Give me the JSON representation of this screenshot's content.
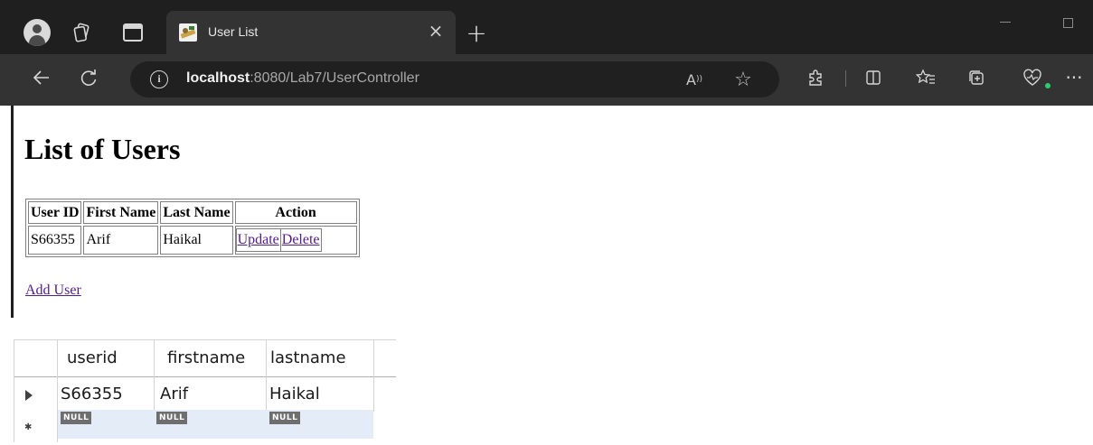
{
  "browser": {
    "tab": {
      "title": "User List"
    },
    "address": {
      "host": "localhost",
      "path": ":8080/Lab7/UserController"
    }
  },
  "page": {
    "title": "List of Users",
    "table": {
      "headers": [
        "User ID",
        "First Name",
        "Last Name",
        "Action"
      ],
      "rows": [
        {
          "userid": "S66355",
          "firstname": "Arif",
          "lastname": "Haikal",
          "update": "Update",
          "delete": "Delete"
        }
      ]
    },
    "add_user_link": "Add User"
  },
  "dbgrid": {
    "columns": [
      "userid",
      "firstname",
      "lastname"
    ],
    "rows": [
      {
        "userid": "S66355",
        "firstname": "Arif",
        "lastname": "Haikal"
      }
    ],
    "new_row": {
      "userid": "NULL",
      "firstname": "NULL",
      "lastname": "NULL"
    }
  },
  "colors": {
    "link": "#551a8b",
    "chrome_dark": "#202020",
    "toolbar": "#333333",
    "selected_row": "#e4edf7"
  },
  "icons": {
    "toolbar": [
      "extensions-icon",
      "split-screen-icon",
      "favorites-icon",
      "collections-icon",
      "browser-essentials-icon",
      "more-icon"
    ]
  }
}
